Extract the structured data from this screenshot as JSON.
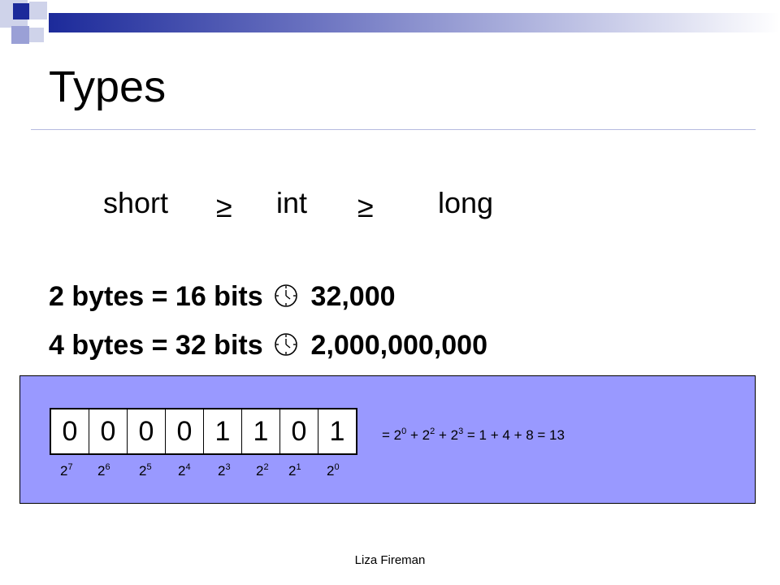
{
  "slide": {
    "title": "Types",
    "comparison": {
      "short": "short",
      "int": "int",
      "long": "long",
      "ge_symbol": "≥"
    },
    "rows": [
      {
        "text": "2 bytes = 16 bits",
        "value": "32,000"
      },
      {
        "text": "4 bytes = 32 bits",
        "value": "2,000,000,000"
      }
    ],
    "bits": [
      "0",
      "0",
      "0",
      "0",
      "1",
      "1",
      "0",
      "1"
    ],
    "powers": [
      {
        "base": "2",
        "exp": "7"
      },
      {
        "base": "2",
        "exp": "6"
      },
      {
        "base": "2",
        "exp": "5"
      },
      {
        "base": "2",
        "exp": "4"
      },
      {
        "base": "2",
        "exp": "3"
      },
      {
        "base": "2",
        "exp": "2"
      },
      {
        "base": "2",
        "exp": "1"
      },
      {
        "base": "2",
        "exp": "0"
      }
    ],
    "equation": {
      "prefix": "= ",
      "terms": [
        {
          "base": "2",
          "exp": "0"
        },
        {
          "base": "2",
          "exp": "2"
        },
        {
          "base": "2",
          "exp": "3"
        }
      ],
      "separator": " + ",
      "suffix": " = 1 + 4 + 8 = 13"
    },
    "footer": "Liza Fireman",
    "icons": {
      "arrow_icon": "clock-icon"
    },
    "colors": {
      "accent": "#1c2a9a",
      "panel": "#9999ff"
    }
  }
}
